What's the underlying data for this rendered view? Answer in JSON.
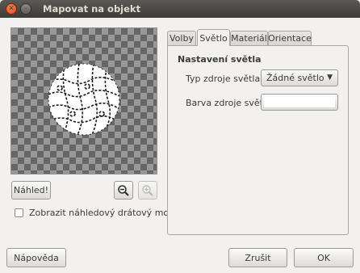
{
  "window": {
    "title": "Mapovat na objekt",
    "close_symbol": "✕",
    "minimize_symbol": "–"
  },
  "preview": {
    "button_label": "Náhled!",
    "zoom_out_icon": "zoom-out-icon",
    "zoom_in_icon": "zoom-in-icon",
    "wireframe_checkbox_label": "Zobrazit náhledový drátový model",
    "wireframe_checked": false
  },
  "tabs": [
    {
      "label": "Volby"
    },
    {
      "label": "Světlo",
      "active": true
    },
    {
      "label": "Materiál"
    },
    {
      "label": "Orientace"
    }
  ],
  "light": {
    "section_title": "Nastavení světla",
    "type_label": "Typ zdroje světla:",
    "type_value": "Žádné světlo",
    "color_label": "Barva zdroje světla:",
    "color_value": "#ffffff"
  },
  "footer": {
    "help_label": "Nápověda",
    "cancel_label": "Zrušit",
    "ok_label": "OK"
  },
  "colors": {
    "checker_dark": "#666666",
    "checker_light": "#999999",
    "titlebar": "#3c3b37",
    "close_button": "#df4a16"
  }
}
